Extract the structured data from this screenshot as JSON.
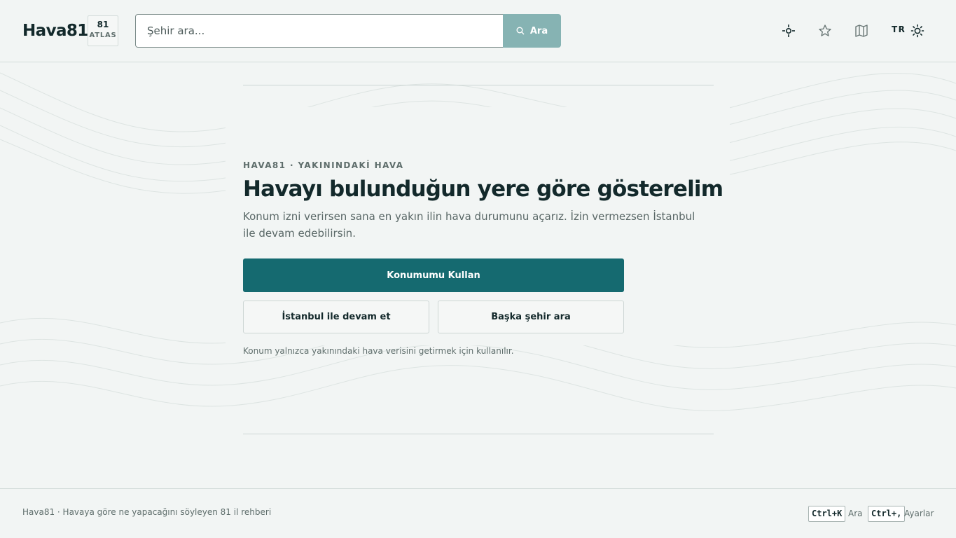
{
  "header": {
    "brand": "Hava81",
    "badge": {
      "number": "81",
      "label": "ATLAS"
    },
    "search": {
      "placeholder": "Şehir ara...",
      "value": "",
      "button_label": "Ara"
    },
    "icons": [
      "locate-icon",
      "star-icon",
      "map-icon",
      "sun-icon"
    ],
    "language": "TR"
  },
  "main": {
    "eyebrow": "HAVA81 · YAKININDAKİ HAVA",
    "title": "Havayı bulunduğun yere göre gösterelim",
    "description": "Konum izni verirsen sana en yakın ilin hava durumunu açarız. İzin vermezsen İstanbul ile devam edebilirsin.",
    "primary_button": "Konumumu Kullan",
    "secondary_buttons": [
      "İstanbul ile devam et",
      "Başka şehir ara"
    ],
    "note": "Konum yalnızca yakınındaki hava verisini getirmek için kullanılır."
  },
  "footer": {
    "text": "Hava81 · Havaya göre ne yapacağını söyleyen 81 il rehberi",
    "shortcuts": [
      {
        "key": "Ctrl+K",
        "label": "Ara"
      },
      {
        "key": "Ctrl+,",
        "label": "Ayarlar"
      }
    ]
  },
  "colors": {
    "background": "#f2f5f4",
    "primary": "#156a70",
    "search_button": "#86b3b3",
    "text": "#13292b"
  }
}
